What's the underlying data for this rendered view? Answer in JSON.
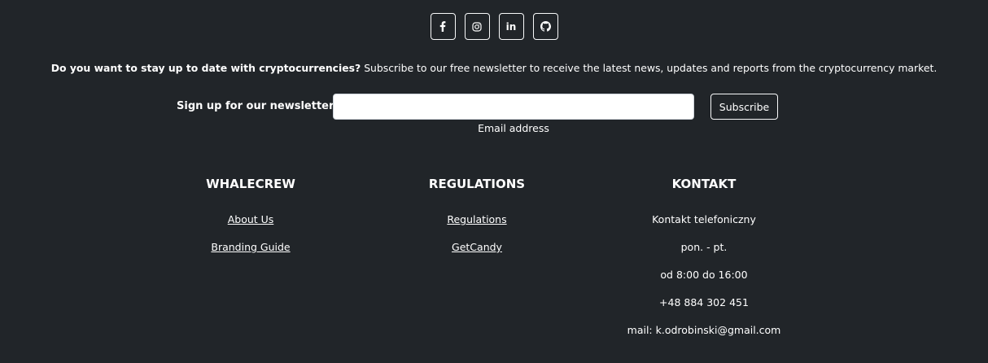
{
  "social": [
    {
      "name": "facebook",
      "icon": "facebook-icon"
    },
    {
      "name": "instagram",
      "icon": "instagram-icon"
    },
    {
      "name": "linkedin",
      "icon": "linkedin-icon"
    },
    {
      "name": "github",
      "icon": "github-icon"
    }
  ],
  "promo": {
    "lead": "Do you want to stay up to date with cryptocurrencies?",
    "text": " Subscribe to our free newsletter to receive the latest news, updates and reports from the cryptocurrency market."
  },
  "newsletter": {
    "label": "Sign up for our newsletter",
    "input_value": "",
    "help": "Email address",
    "submit": "Subscribe"
  },
  "columns": {
    "whalecrew": {
      "heading": "WHALECREW",
      "links": [
        "About Us",
        "Branding Guide"
      ]
    },
    "regulations": {
      "heading": "REGULATIONS",
      "links": [
        "Regulations",
        "GetCandy"
      ]
    },
    "kontakt": {
      "heading": "KONTAKT",
      "lines": [
        "Kontakt telefoniczny",
        "pon. - pt.",
        "od 8:00 do 16:00",
        "+48 884 302 451",
        "mail: k.odrobinski@gmail.com"
      ]
    }
  },
  "colors": {
    "background": "#212529",
    "text": "#ffffff",
    "outline": "#f8f9fa"
  }
}
